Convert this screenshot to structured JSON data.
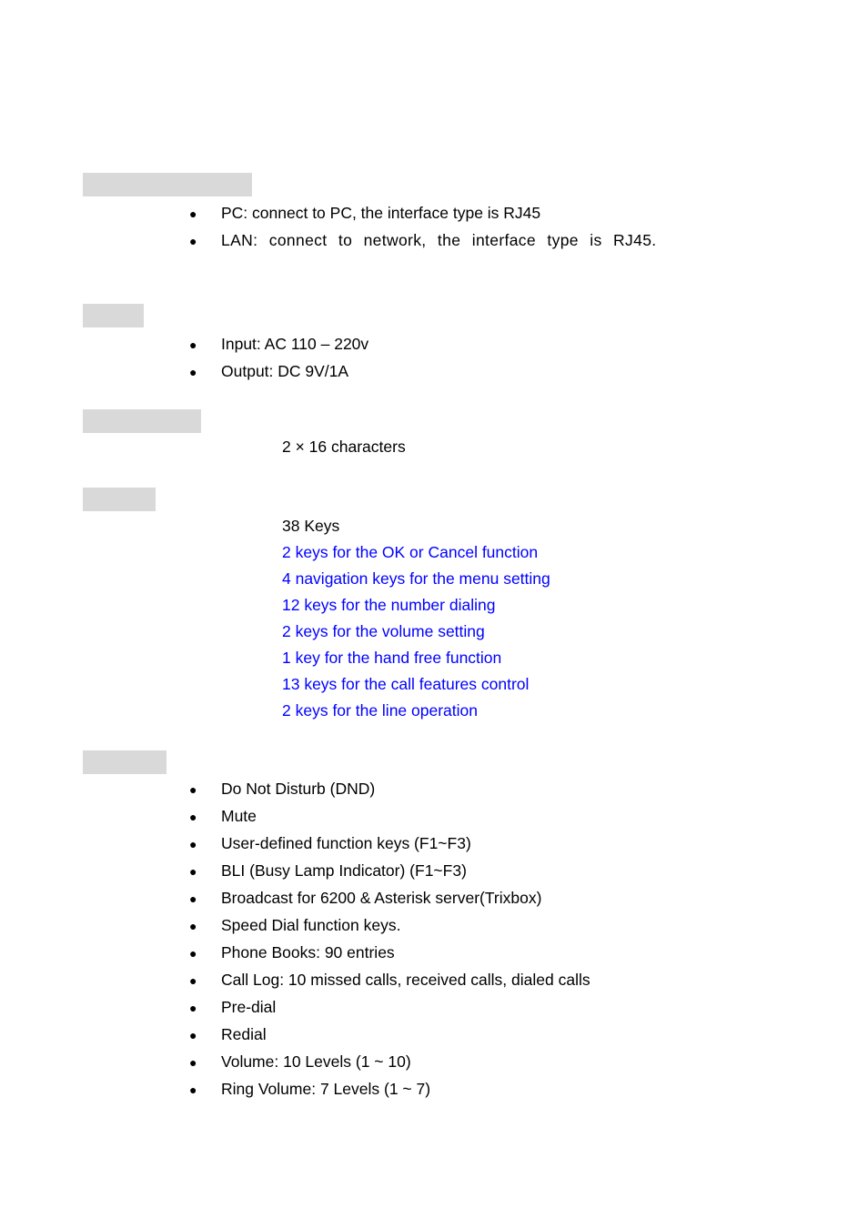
{
  "document": {
    "page_background": "#ffffff",
    "highlight_color": "#d9d9d9",
    "accent_text_color": "#0000ff",
    "body_text_color": "#000000",
    "bullet_glyph": "●"
  },
  "sections": [
    {
      "id": "interface",
      "header_redacted": true,
      "header_text": "",
      "bullets": [
        {
          "text": "PC: connect to PC, the interface type is RJ45",
          "justified": false
        },
        {
          "text": "LAN: connect to network, the interface type is RJ45.",
          "justified": true
        }
      ]
    },
    {
      "id": "power",
      "header_redacted": true,
      "header_text": "",
      "bullets": [
        {
          "text": "Input: AC 110 – 220v",
          "justified": false
        },
        {
          "text": "Output: DC 9V/1A",
          "justified": false
        }
      ]
    },
    {
      "id": "display",
      "header_redacted": true,
      "header_text": "",
      "plain_lines": [
        {
          "text": "2 × 16 characters"
        }
      ]
    },
    {
      "id": "keypad",
      "header_redacted": true,
      "header_text": "",
      "key_lines": [
        {
          "text": "38 Keys",
          "accent": false
        },
        {
          "text": "2 keys for the OK or Cancel function",
          "accent": true
        },
        {
          "text": "4 navigation keys for the menu setting",
          "accent": true
        },
        {
          "text": "12 keys for the number dialing",
          "accent": true
        },
        {
          "text": "2 keys for the volume setting",
          "accent": true
        },
        {
          "text": "1 key for the hand free function",
          "accent": true
        },
        {
          "text": "13 keys for the call features control",
          "accent": true
        },
        {
          "text": "2 keys for the line operation",
          "accent": true
        }
      ]
    },
    {
      "id": "features",
      "header_redacted": true,
      "header_text": "",
      "bullets": [
        {
          "text": "Do Not Disturb (DND)",
          "justified": false
        },
        {
          "text": "Mute",
          "justified": false
        },
        {
          "text": "User-defined function keys (F1~F3)",
          "justified": false
        },
        {
          "text": "BLI (Busy Lamp Indicator) (F1~F3)",
          "justified": false
        },
        {
          "text": "Broadcast for 6200 & Asterisk server(Trixbox)",
          "justified": false
        },
        {
          "text": "Speed Dial function keys.",
          "justified": false
        },
        {
          "text": "Phone Books: 90 entries",
          "justified": false
        },
        {
          "text": "Call Log:  10 missed calls, received calls, dialed calls",
          "justified": false
        },
        {
          "text": "Pre-dial",
          "justified": false
        },
        {
          "text": "Redial",
          "justified": false
        },
        {
          "text": "Volume: 10 Levels (1 ~ 10)",
          "justified": false
        },
        {
          "text": "Ring Volume: 7 Levels (1 ~ 7)",
          "justified": false
        }
      ]
    }
  ]
}
